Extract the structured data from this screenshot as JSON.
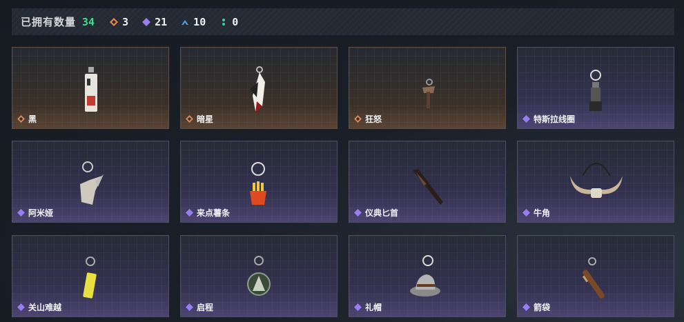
{
  "header": {
    "owned_label": "已拥有数量",
    "owned_count": "34",
    "stats": [
      {
        "icon": "orange-diamond-icon",
        "value": "3",
        "color": "#e8834a"
      },
      {
        "icon": "purple-diamond-icon",
        "value": "21",
        "color": "#9a7df0"
      },
      {
        "icon": "blue-chevron-icon",
        "value": "10",
        "color": "#4aa3e8"
      },
      {
        "icon": "green-dots-icon",
        "value": "0",
        "color": "#3fd0a0"
      }
    ]
  },
  "items": [
    {
      "name": "黑",
      "tier": "orange",
      "art": "tag-keychain"
    },
    {
      "name": "暗星",
      "tier": "orange",
      "art": "feather-keychain"
    },
    {
      "name": "狂怒",
      "tier": "orange",
      "art": "axe-keychain"
    },
    {
      "name": "特斯拉线圈",
      "tier": "purple",
      "art": "coil-keychain"
    },
    {
      "name": "阿米娅",
      "tier": "purple",
      "art": "figure-keychain"
    },
    {
      "name": "来点薯条",
      "tier": "purple",
      "art": "fries-keychain"
    },
    {
      "name": "仪典匕首",
      "tier": "purple",
      "art": "dagger-keychain"
    },
    {
      "name": "牛角",
      "tier": "purple",
      "art": "horns-keychain"
    },
    {
      "name": "关山难越",
      "tier": "purple",
      "art": "can-keychain"
    },
    {
      "name": "启程",
      "tier": "purple",
      "art": "medallion-keychain"
    },
    {
      "name": "礼帽",
      "tier": "purple",
      "art": "hat-keychain"
    },
    {
      "name": "箭袋",
      "tier": "purple",
      "art": "quiver-keychain"
    }
  ]
}
